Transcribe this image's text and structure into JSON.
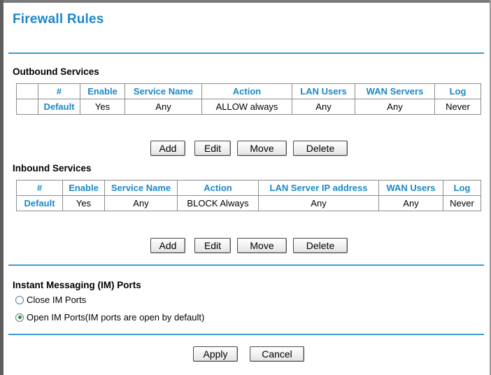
{
  "page": {
    "title": "Firewall Rules"
  },
  "outbound": {
    "heading": "Outbound Services",
    "columns": [
      "",
      "#",
      "Enable",
      "Service Name",
      "Action",
      "LAN Users",
      "WAN Servers",
      "Log"
    ],
    "rows": [
      {
        "select": "",
        "id": "Default",
        "enable": "Yes",
        "service": "Any",
        "action": "ALLOW always",
        "lan": "Any",
        "wan": "Any",
        "log": "Never"
      }
    ],
    "buttons": {
      "add": "Add",
      "edit": "Edit",
      "move": "Move",
      "delete": "Delete"
    }
  },
  "inbound": {
    "heading": "Inbound Services",
    "columns": [
      "#",
      "Enable",
      "Service Name",
      "Action",
      "LAN Server IP address",
      "WAN Users",
      "Log"
    ],
    "rows": [
      {
        "id": "Default",
        "enable": "Yes",
        "service": "Any",
        "action": "BLOCK Always",
        "lan": "Any",
        "wan": "Any",
        "log": "Never"
      }
    ],
    "buttons": {
      "add": "Add",
      "edit": "Edit",
      "move": "Move",
      "delete": "Delete"
    }
  },
  "im": {
    "heading": "Instant Messaging (IM) Ports",
    "options": [
      {
        "label": "Close IM Ports",
        "selected": false
      },
      {
        "label": "Open IM Ports(IM ports are open by default)",
        "selected": true
      }
    ]
  },
  "footer": {
    "apply": "Apply",
    "cancel": "Cancel"
  },
  "colors": {
    "accent": "#1a88c8",
    "rule": "#3b9bd1"
  }
}
